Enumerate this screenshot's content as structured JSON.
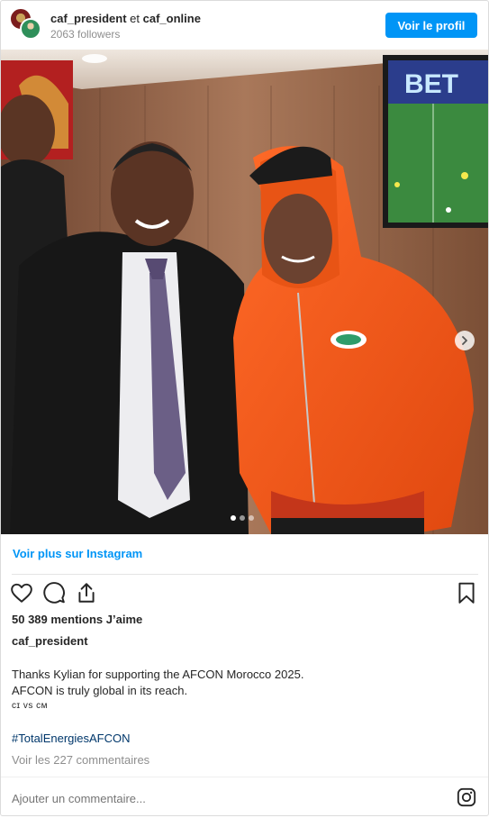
{
  "header": {
    "account1": "caf_president",
    "separator": "et",
    "account2": "caf_online",
    "followers": "2063 followers",
    "profile_button": "Voir le profil"
  },
  "photo": {
    "tv_text": "BET",
    "carousel_total": 3,
    "carousel_active": 1
  },
  "footer": {
    "more_link": "Voir plus sur Instagram",
    "likes": "50 389 mentions J’aime",
    "author": "caf_president",
    "caption_line1": "Thanks Kylian for supporting the AFCON Morocco 2025.",
    "caption_line2": "AFCON is truly global in its reach.",
    "caption_line3": "ᴄɪ ᴠs ᴄᴍ",
    "hashtag": "#TotalEnergiesAFCON",
    "comments": "Voir les 227 commentaires",
    "comment_placeholder": "Ajouter un commentaire..."
  },
  "colors": {
    "accent": "#0095f6",
    "hoodie": "#f2571a",
    "wall": "#9a6a4a"
  },
  "icons": [
    "heart-icon",
    "comment-icon",
    "share-icon",
    "bookmark-icon",
    "chevron-right-icon",
    "instagram-icon"
  ]
}
